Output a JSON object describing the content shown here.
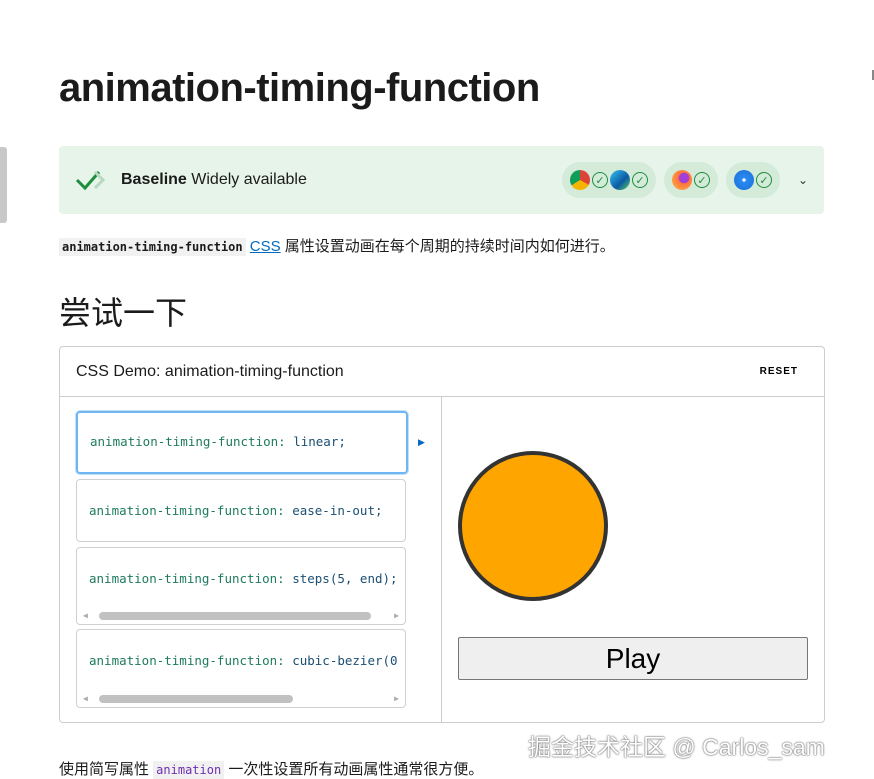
{
  "title": "animation-timing-function",
  "baseline": {
    "label": "Baseline",
    "status": "Widely available",
    "browsers": [
      "chrome",
      "edge",
      "firefox",
      "safari"
    ],
    "color": "#e6f4ea"
  },
  "intro": {
    "code": "animation-timing-function",
    "link": "CSS",
    "text": " 属性设置动画在每个周期的持续时间内如何进行。"
  },
  "try_heading": "尝试一下",
  "demo": {
    "title": "CSS Demo: animation-timing-function",
    "reset": "RESET",
    "options": [
      {
        "prop": "animation-timing-function: ",
        "value": "linear;",
        "selected": true
      },
      {
        "prop": "animation-timing-function: ",
        "value": "ease-in-out;"
      },
      {
        "prop": "animation-timing-function: ",
        "value": "steps(5, end);"
      },
      {
        "prop": "animation-timing-function: ",
        "value": "cubic-bezier(0"
      }
    ],
    "play": "Play",
    "circle_color": "#ffa500"
  },
  "footer": {
    "pre": "使用简写属性 ",
    "code": "animation",
    "post": " 一次性设置所有动画属性通常很方便。"
  },
  "watermark": "掘金技术社区 @ Carlos_sam"
}
